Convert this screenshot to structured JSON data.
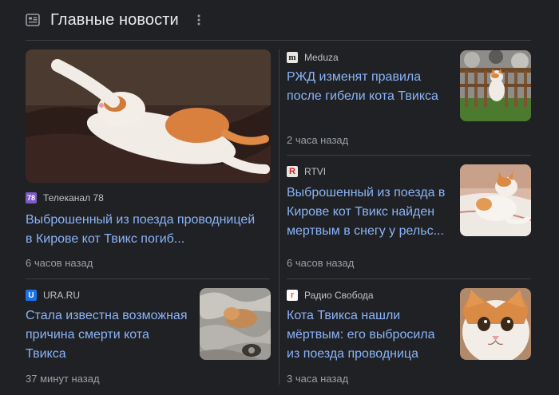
{
  "header": {
    "title": "Главные новости"
  },
  "cards": [
    {
      "source": "Телеканал 78",
      "logo_text": "78",
      "headline": "Выброшенный из поезда проводницей в Кирове кот Твикс погиб...",
      "time": "6 часов назад",
      "image": "cat-lying-on-sofa"
    },
    {
      "source": "Meduza",
      "logo_text": "m",
      "headline": "РЖД изменят правила после гибели кота Твикса",
      "time": "2 часа назад",
      "image": "cat-behind-fence"
    },
    {
      "source": "RTVI",
      "logo_text": "R",
      "headline": "Выброшенный из поезда в Кирове кот Твикс найден мертвым в снегу у рельс...",
      "time": "6 часов назад",
      "image": "cat-on-bed"
    },
    {
      "source": "URA.RU",
      "logo_text": "U",
      "headline": "Стала известна возможная причина смерти кота Твикса",
      "time": "37 минут назад",
      "image": "cat-on-blanket"
    },
    {
      "source": "Радио Свобода",
      "logo_text": "r",
      "headline": "Кота Твикса нашли мёртвым: его выбросила из поезда проводница",
      "time": "3 часа назад",
      "image": "cat-face-closeup"
    }
  ],
  "colors": {
    "background": "#202124",
    "link": "#8ab4f8",
    "divider": "#3c4043"
  }
}
